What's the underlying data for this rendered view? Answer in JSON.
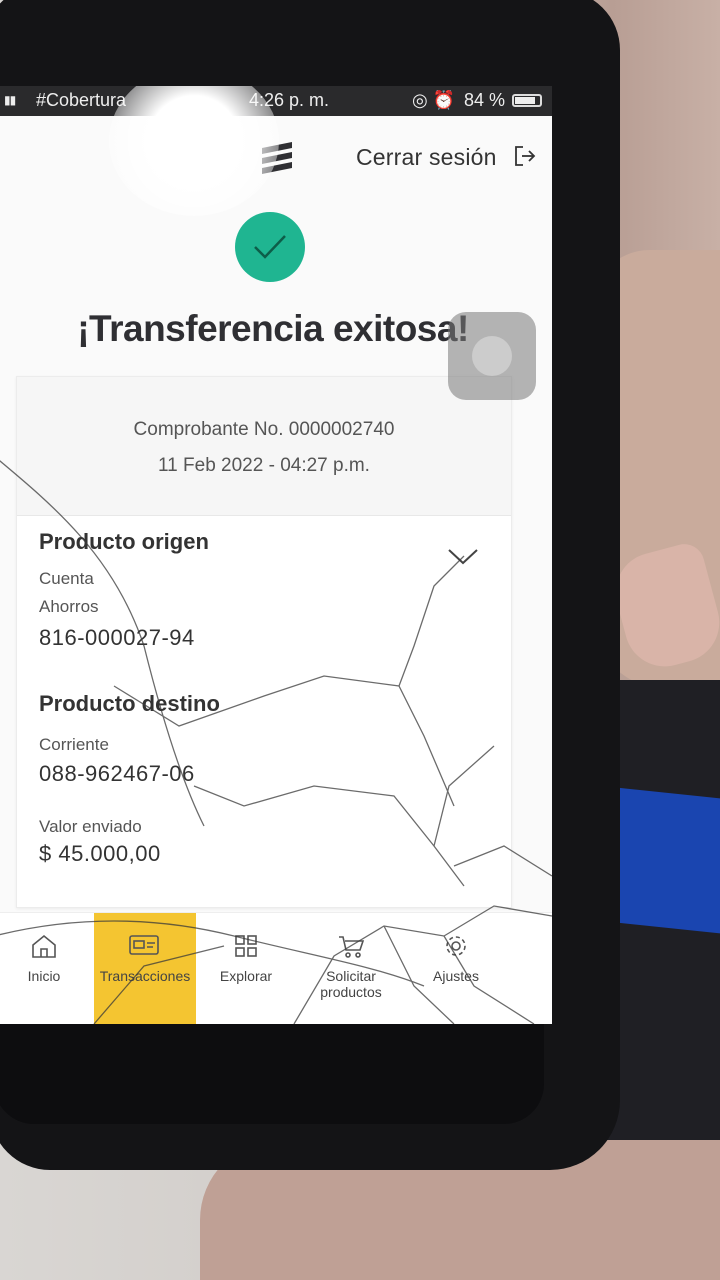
{
  "status_bar": {
    "carrier": "#Cobertura",
    "time": "4:26 p. m.",
    "battery": "84 %",
    "battery_level": 0.84
  },
  "header": {
    "logout_label": "Cerrar sesión"
  },
  "result": {
    "title": "¡Transferencia exitosa!",
    "voucher": "Comprobante No. 0000002740",
    "datetime": "11 Feb 2022 - 04:27 p.m."
  },
  "origin": {
    "title": "Producto origen",
    "type": "Cuenta",
    "subtype": "Ahorros",
    "number": "816-000027-94"
  },
  "destination": {
    "title": "Producto destino",
    "type": "Corriente",
    "number": "088-962467-06"
  },
  "amount": {
    "label": "Valor enviado",
    "value": "$ 45.000,00"
  },
  "tabbar": {
    "items": [
      {
        "label": "Inicio",
        "icon": "home-icon"
      },
      {
        "label": "Transacciones",
        "icon": "transactions-icon",
        "active": true
      },
      {
        "label": "Explorar",
        "icon": "grid-icon"
      },
      {
        "label": "Solicitar productos",
        "icon": "cart-icon"
      },
      {
        "label": "Ajustes",
        "icon": "gear-icon"
      }
    ]
  },
  "colors": {
    "success": "#1fb591",
    "active_tab": "#f4c531"
  }
}
